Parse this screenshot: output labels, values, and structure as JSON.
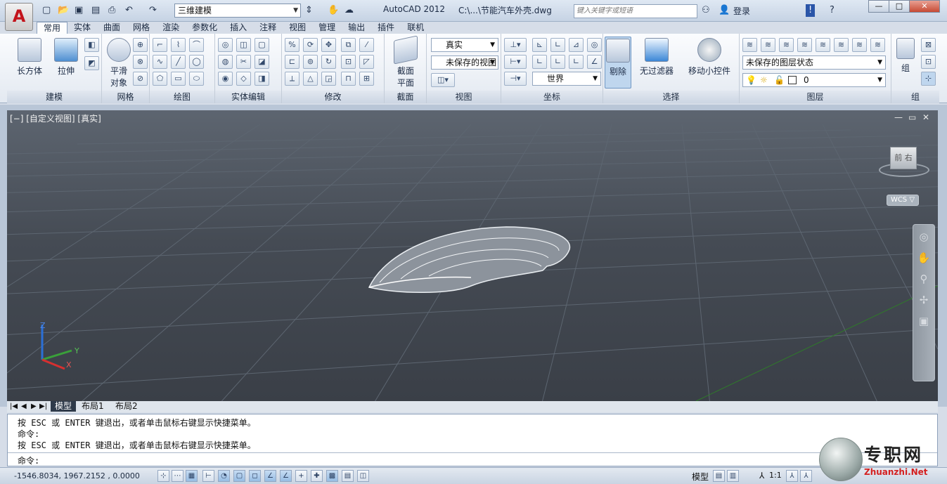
{
  "app": {
    "title": "AutoCAD 2012",
    "file": "C:\\...\\节能汽车外壳.dwg",
    "logo": "A"
  },
  "workspace": {
    "value": "三维建模"
  },
  "search": {
    "placeholder": "键入关键字或短语"
  },
  "user": {
    "login_label": "登录"
  },
  "window_buttons": [
    "—",
    "□",
    "✕"
  ],
  "tabs": [
    "常用",
    "实体",
    "曲面",
    "网格",
    "渲染",
    "参数化",
    "插入",
    "注释",
    "视图",
    "管理",
    "输出",
    "插件",
    "联机"
  ],
  "active_tab": "常用",
  "ribbon": {
    "modeling": {
      "title": "建模",
      "box": "长方体",
      "extrude": "拉伸"
    },
    "mesh": {
      "title": "网格",
      "smooth_l1": "平滑",
      "smooth_l2": "对象"
    },
    "draw": {
      "title": "绘图"
    },
    "solid_edit": {
      "title": "实体编辑"
    },
    "modify": {
      "title": "修改"
    },
    "section": {
      "title": "截面",
      "plane_l1": "截面",
      "plane_l2": "平面"
    },
    "view": {
      "title": "视图",
      "visual_style": "真实",
      "saved_view": "未保存的视图"
    },
    "coordinates": {
      "title": "坐标",
      "ucs": "世界"
    },
    "selection": {
      "title": "选择",
      "cull": "剔除",
      "filter": "无过滤器",
      "gizmo": "移动小控件"
    },
    "layers": {
      "title": "图层",
      "layer_state": "未保存的图层状态",
      "current_layer": "0"
    },
    "groups": {
      "title": "组",
      "group": "组"
    }
  },
  "viewport": {
    "label": "[−] [自定义视图] [真实]",
    "controls": [
      "—",
      "▭",
      "✕"
    ],
    "navcube_labels": [
      "前",
      "右"
    ],
    "wcs": "WCS",
    "axes": {
      "x": "X",
      "y": "Y",
      "z": "Z"
    }
  },
  "layout_tabs": [
    "模型",
    "布局1",
    "布局2"
  ],
  "command": {
    "lines": [
      "按 ESC 或 ENTER 键退出，或者单击鼠标右键显示快捷菜单。",
      "命令:",
      "按 ESC 或 ENTER 键退出，或者单击鼠标右键显示快捷菜单。"
    ],
    "prompt": "命令:"
  },
  "status": {
    "coordinates": "-1546.8034,  1967.2152 , 0.0000",
    "model": "模型",
    "scale": "1:1"
  },
  "watermark": {
    "text": "专职网",
    "url": "Zhuanzhi.Net"
  }
}
